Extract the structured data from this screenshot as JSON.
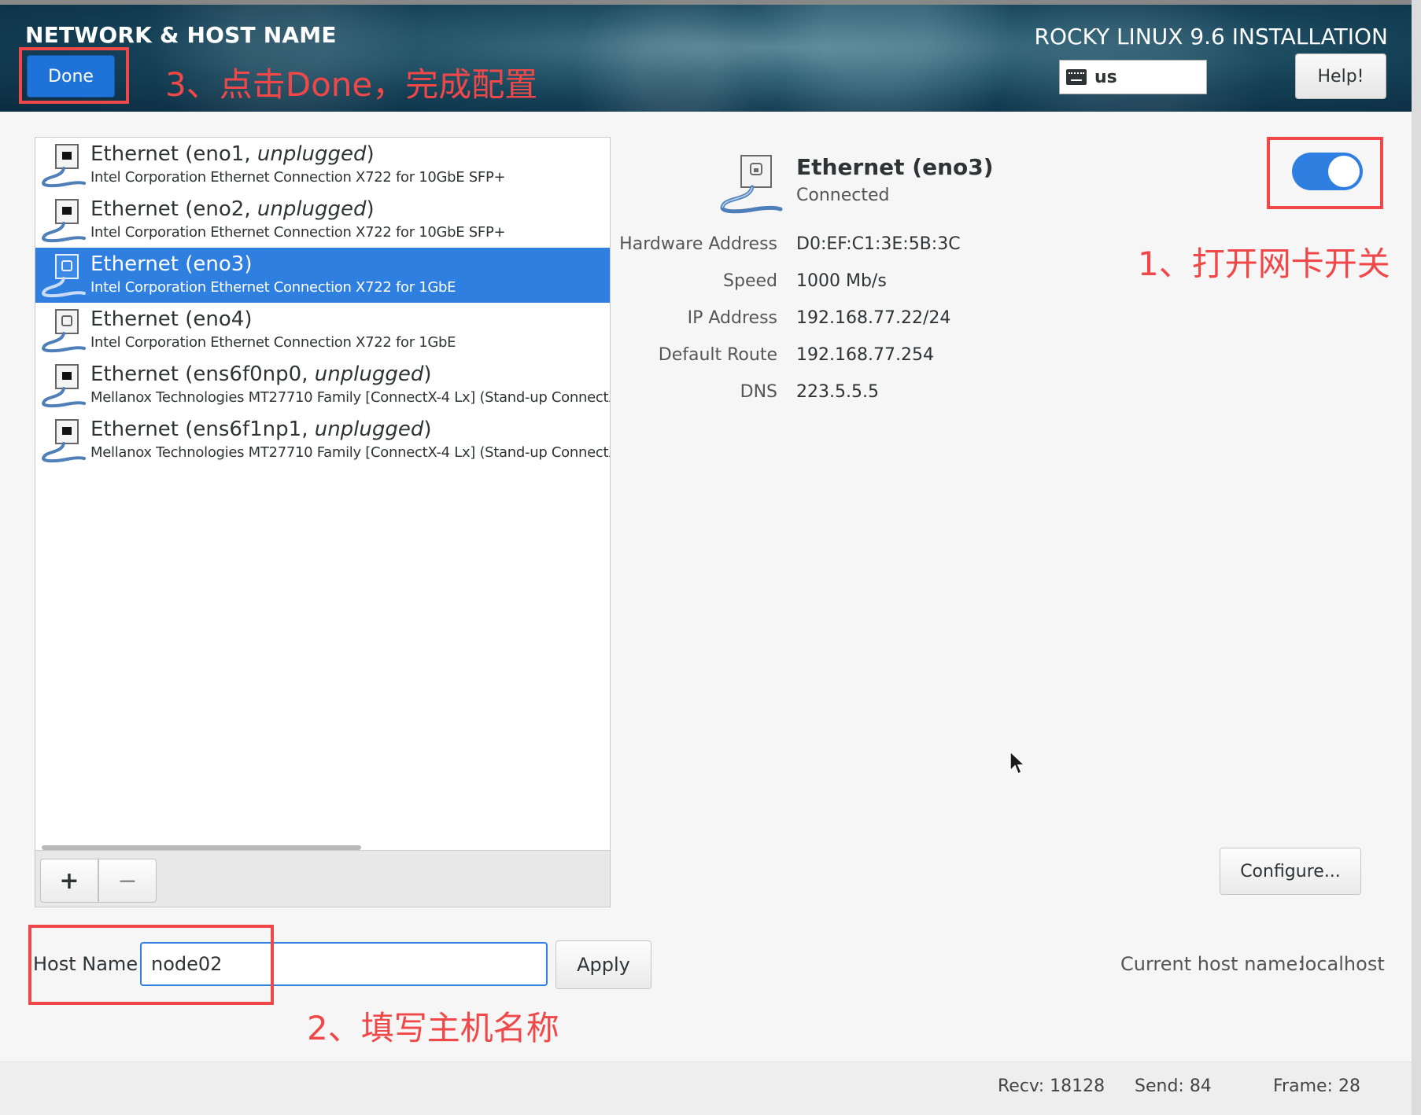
{
  "header": {
    "page_title": "NETWORK & HOST NAME",
    "done_label": "Done",
    "product_title": "ROCKY LINUX 9.6 INSTALLATION",
    "keyboard_layout": "us",
    "help_label": "Help!"
  },
  "annotations": {
    "step1": "1、打开网卡开关",
    "step2": "2、填写主机名称",
    "step3": "3、点击Done，完成配置",
    "color": "#f04848"
  },
  "devices": [
    {
      "name": "Ethernet (eno1, ",
      "state": "unplugged",
      "suffix": ")",
      "description": "Intel Corporation Ethernet Connection X722 for 10GbE SFP+",
      "selected": false
    },
    {
      "name": "Ethernet (eno2, ",
      "state": "unplugged",
      "suffix": ")",
      "description": "Intel Corporation Ethernet Connection X722 for 10GbE SFP+",
      "selected": false
    },
    {
      "name": "Ethernet (eno3)",
      "state": "",
      "suffix": "",
      "description": "Intel Corporation Ethernet Connection X722 for 1GbE",
      "selected": true
    },
    {
      "name": "Ethernet (eno4)",
      "state": "",
      "suffix": "",
      "description": "Intel Corporation Ethernet Connection X722 for 1GbE",
      "selected": false
    },
    {
      "name": "Ethernet (ens6f0np0, ",
      "state": "unplugged",
      "suffix": ")",
      "description": "Mellanox Technologies MT27710 Family [ConnectX-4 Lx] (Stand-up ConnectX-",
      "selected": false
    },
    {
      "name": "Ethernet (ens6f1np1, ",
      "state": "unplugged",
      "suffix": ")",
      "description": "Mellanox Technologies MT27710 Family [ConnectX-4 Lx] (Stand-up ConnectX-",
      "selected": false
    }
  ],
  "list_toolbar": {
    "add_label": "+",
    "remove_label": "−"
  },
  "detail": {
    "name": "Ethernet (eno3)",
    "status": "Connected",
    "toggle_on": true,
    "properties": {
      "hw_label": "Hardware Address",
      "hw_value": "D0:EF:C1:3E:5B:3C",
      "speed_label": "Speed",
      "speed_value": "1000 Mb/s",
      "ip_label": "IP Address",
      "ip_value": "192.168.77.22/24",
      "route_label": "Default Route",
      "route_value": "192.168.77.254",
      "dns_label": "DNS",
      "dns_value": "223.5.5.5"
    },
    "configure_label": "Configure..."
  },
  "hostname": {
    "label": "Host Name:",
    "value": "node02",
    "apply_label": "Apply",
    "current_label": "Current host name:",
    "current_value": "localhost"
  },
  "statusbar": {
    "recv": "Recv: 18128",
    "send": "Send: 84",
    "frame": "Frame: 28"
  },
  "colors": {
    "accent": "#2f7fe0",
    "annotation": "#f04848",
    "header_bg": "#143f55"
  }
}
